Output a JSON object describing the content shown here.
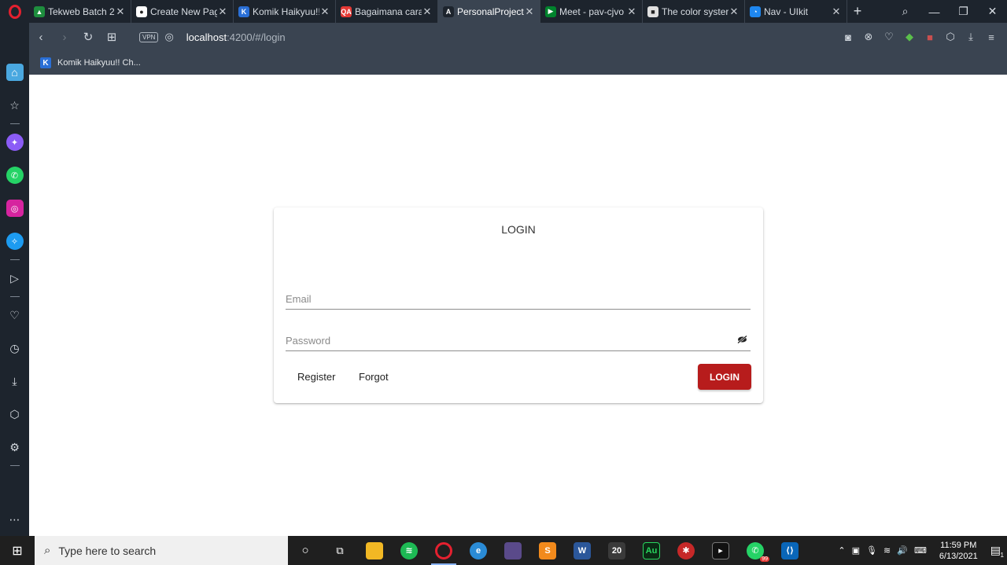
{
  "browser": {
    "tabs": [
      {
        "title": "Tekweb Batch 2",
        "fav_color": "#1e8e3e",
        "fav_text": "▲",
        "active": false
      },
      {
        "title": "Create New Pag",
        "fav_color": "#ffffff",
        "fav_text": "●",
        "active": false
      },
      {
        "title": "Komik Haikyuu!!",
        "fav_color": "#2a6fd6",
        "fav_text": "K",
        "active": false
      },
      {
        "title": "Bagaimana cara",
        "fav_color": "#e53935",
        "fav_text": "QA",
        "active": false
      },
      {
        "title": "PersonalProject",
        "fav_color": "#1d242d",
        "fav_text": "A",
        "active": true
      },
      {
        "title": "Meet - pav-cjvo",
        "fav_color": "#00832d",
        "fav_text": "▶",
        "active": false
      },
      {
        "title": "The color syster",
        "fav_color": "#e0e0e0",
        "fav_text": "■",
        "active": false
      },
      {
        "title": "Nav - UIkit",
        "fav_color": "#1e87f0",
        "fav_text": "◔",
        "active": false
      }
    ],
    "new_tab": "+",
    "address": {
      "host": "localhost",
      "path": ":4200/#/login",
      "vpn_label": "VPN"
    },
    "bookmarks": [
      {
        "label": "Komik Haikyuu!! Ch...",
        "fav_text": "K"
      }
    ]
  },
  "login_card": {
    "title": "LOGIN",
    "email_placeholder": "Email",
    "password_placeholder": "Password",
    "register_label": "Register",
    "forgot_label": "Forgot",
    "login_label": "LOGIN"
  },
  "taskbar": {
    "search_placeholder": "Type here to search",
    "time": "11:59 PM",
    "date": "6/13/2021",
    "whatsapp_badge": "99",
    "notification_count": "1",
    "calendar_app_label": "20",
    "audition_label": "Au"
  },
  "colors": {
    "accent": "#b71c1c",
    "browser_dark": "#1d242d",
    "browser_bar": "#3a4451"
  }
}
